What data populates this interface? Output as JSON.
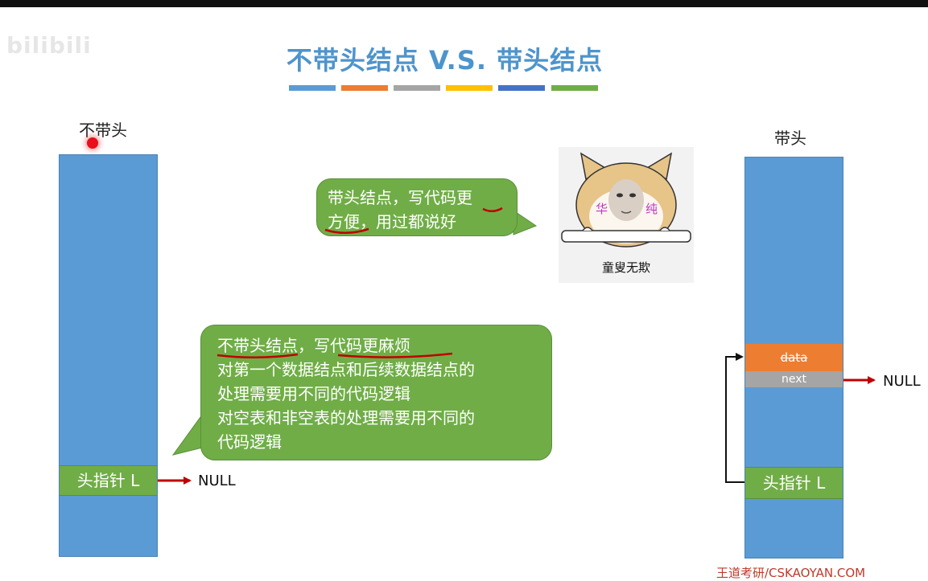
{
  "watermark": "bilibili",
  "title": "不带头结点 V.S. 带头结点",
  "accent_colors": [
    "#5b9bd5",
    "#ed7d31",
    "#a5a5a5",
    "#ffc000",
    "#4472c4",
    "#70ad47"
  ],
  "left": {
    "label": "不带头",
    "head_pointer": "头指针 L",
    "null": "NULL"
  },
  "right": {
    "label": "带头",
    "data": "data",
    "next": "next",
    "head_pointer": "头指针 L",
    "null": "NULL"
  },
  "bubble_top": {
    "lines": [
      "带头结点，写代码更",
      "方便，用过都说好"
    ]
  },
  "bubble_main": {
    "lines": [
      "不带头结点，写代码更麻烦",
      "对第一个数据结点和后续数据结点的",
      "处理需要用不同的代码逻辑",
      "对空表和非空表的处理需要用不同的",
      "代码逻辑"
    ]
  },
  "meme": {
    "caption": "童叟无欺",
    "cheek_text": [
      "华",
      "纯"
    ]
  },
  "footer": "王道考研/CSKAOYAN.COM"
}
